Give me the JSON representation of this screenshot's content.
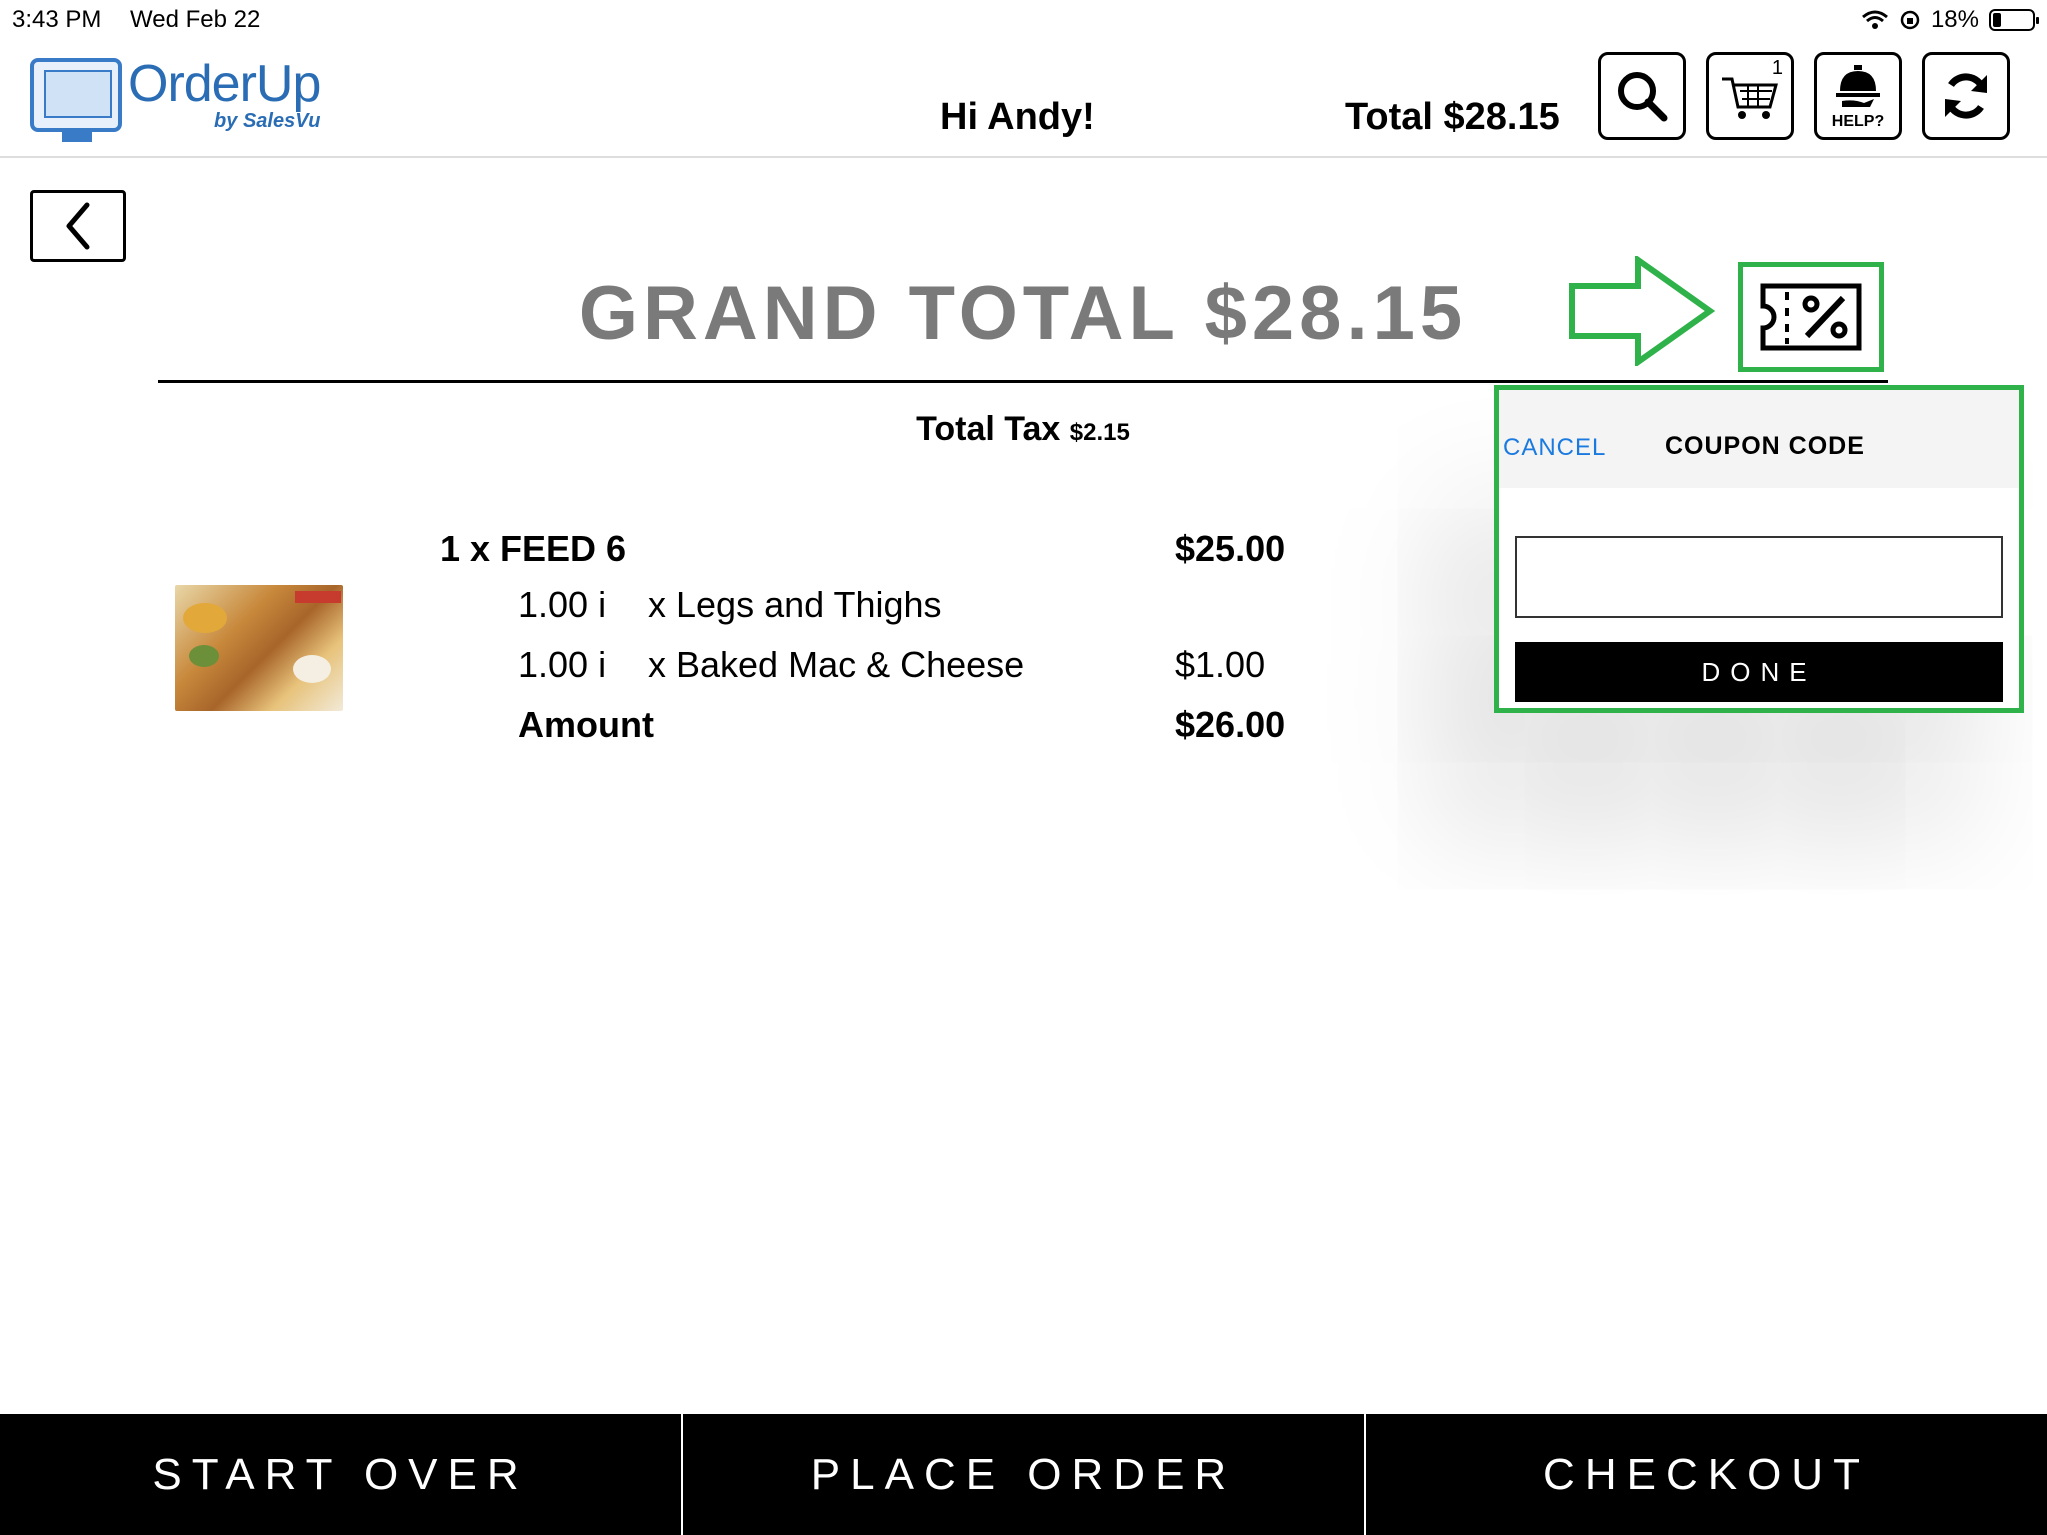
{
  "status": {
    "time": "3:43 PM",
    "date": "Wed Feb 22",
    "battery": "18%",
    "battery_level": 0.18
  },
  "header": {
    "brand": "OrderUp",
    "brand_sub": "by SalesVu",
    "greeting": "Hi Andy!",
    "total": "Total $28.15",
    "cart_count": "1",
    "help_label": "HELP?"
  },
  "summary": {
    "grand_total": "GRAND TOTAL $28.15",
    "tax_label": "Total Tax",
    "tax_value": "$2.15"
  },
  "item": {
    "title": "1 x FEED 6",
    "price": "$25.00",
    "modifiers": [
      {
        "qty": "1.00 i",
        "name": "x Legs and Thighs",
        "price": ""
      },
      {
        "qty": "1.00 i",
        "name": "x Baked Mac & Cheese",
        "price": "$1.00"
      }
    ],
    "amount_label": "Amount",
    "amount_value": "$26.00"
  },
  "coupon": {
    "cancel": "CANCEL",
    "title": "COUPON CODE",
    "input_value": "",
    "done": "DONE"
  },
  "footer": {
    "start_over": "START OVER",
    "place_order": "PLACE ORDER",
    "checkout": "CHECKOUT"
  },
  "colors": {
    "highlight": "#2fb24a",
    "link": "#1a7ae0",
    "brand": "#2a6db5"
  }
}
